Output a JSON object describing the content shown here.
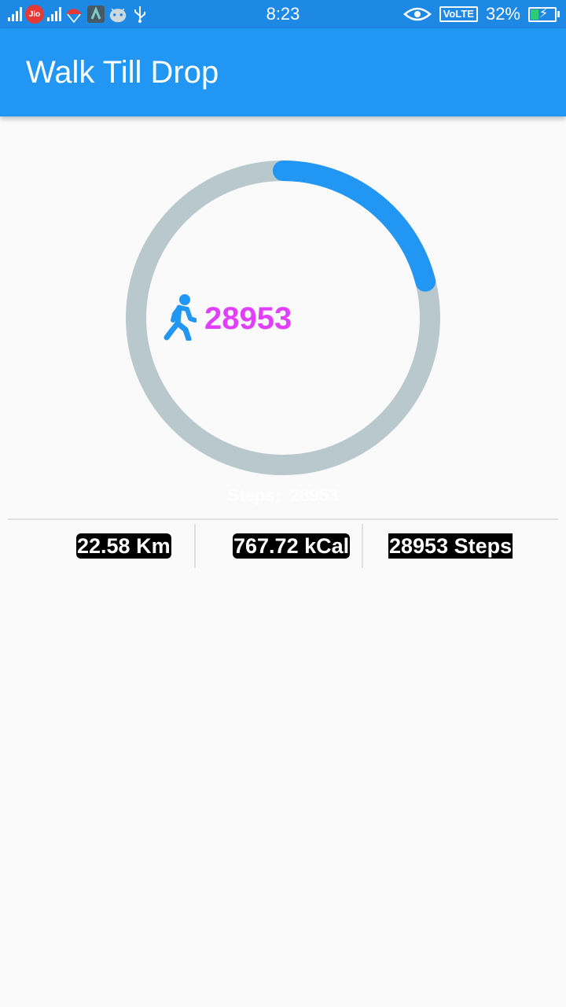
{
  "status_bar": {
    "carrier_badge": "Jio",
    "time": "8:23",
    "volte": "VoLTE",
    "battery": "32%",
    "icons": [
      "signal-icon",
      "jio-icon",
      "signal-icon",
      "parachute-icon",
      "app-icon",
      "android-icon",
      "usb-icon",
      "eye-icon",
      "battery-icon"
    ]
  },
  "app_bar": {
    "title": "Walk Till Drop"
  },
  "progress": {
    "count": "28953",
    "fraction": 0.21,
    "track_color": "#b8c8cc",
    "progress_color": "#2196f3",
    "count_color": "#e040fb",
    "icon": "walking-person-icon"
  },
  "caption": "Steps:  28953",
  "stats": {
    "distance": "22.58 Km",
    "calories": "767.72 kCal",
    "steps": "28953 Steps"
  }
}
